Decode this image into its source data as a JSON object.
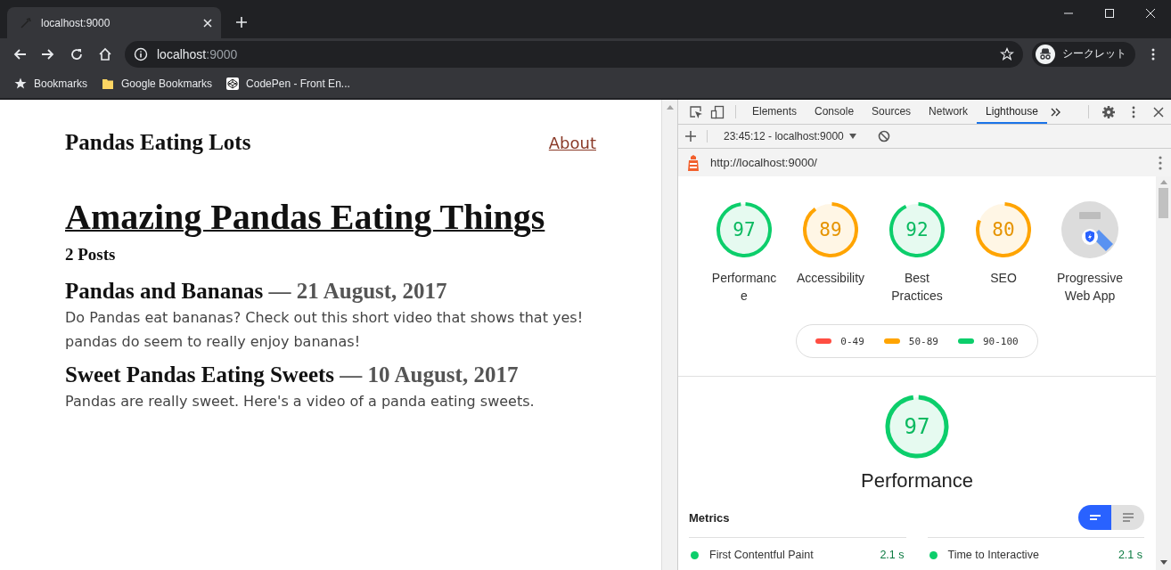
{
  "browser": {
    "tab_title": "localhost:9000",
    "url_host": "localhost",
    "url_port": ":9000",
    "profile_label": "シークレット",
    "bookmarks": [
      {
        "kind": "star",
        "label": "Bookmarks"
      },
      {
        "kind": "folder",
        "label": "Google Bookmarks"
      },
      {
        "kind": "codepen",
        "label": "CodePen - Front En..."
      }
    ]
  },
  "page": {
    "site_title": "Pandas Eating Lots",
    "nav_link": "About",
    "heading": "Amazing Pandas Eating Things",
    "post_count": "2 Posts",
    "posts": [
      {
        "title": "Pandas and Bananas",
        "date": "— 21 August, 2017",
        "excerpt": "Do Pandas eat bananas? Check out this short video that shows that yes! pandas do seem to really enjoy bananas!"
      },
      {
        "title": "Sweet Pandas Eating Sweets",
        "date": "— 10 August, 2017",
        "excerpt": "Pandas are really sweet. Here's a video of a panda eating sweets."
      }
    ]
  },
  "devtools": {
    "tabs": [
      {
        "label": "Elements",
        "selected": false
      },
      {
        "label": "Console",
        "selected": false
      },
      {
        "label": "Sources",
        "selected": false
      },
      {
        "label": "Network",
        "selected": false
      },
      {
        "label": "Lighthouse",
        "selected": true
      }
    ],
    "report_select": "23:45:12 - localhost:9000",
    "report_url": "http://localhost:9000/",
    "gauges": [
      {
        "kind": "score",
        "score": "97",
        "label": "Performance",
        "color": "#0cce6b"
      },
      {
        "kind": "score",
        "score": "89",
        "label": "Accessibility",
        "color": "#ffa400"
      },
      {
        "kind": "score",
        "score": "92",
        "label": "Best Practices",
        "color": "#0cce6b"
      },
      {
        "kind": "score",
        "score": "80",
        "label": "SEO",
        "color": "#ffa400"
      },
      {
        "kind": "pwa",
        "label": "Progressive Web App"
      }
    ],
    "legend": [
      {
        "range": "0-49",
        "color": "#ff4e42"
      },
      {
        "range": "50-89",
        "color": "#ffa400"
      },
      {
        "range": "90-100",
        "color": "#0cce6b"
      }
    ],
    "category": {
      "score": "97",
      "label": "Performance",
      "color": "#0cce6b"
    },
    "metrics_title": "Metrics",
    "views": [
      {
        "selected": true
      },
      {
        "selected": false
      }
    ],
    "metrics": [
      {
        "name": "First Contentful Paint",
        "value": "2.1 s",
        "color": "#0cce6b"
      },
      {
        "name": "Time to Interactive",
        "value": "2.1 s",
        "color": "#0cce6b"
      }
    ]
  }
}
